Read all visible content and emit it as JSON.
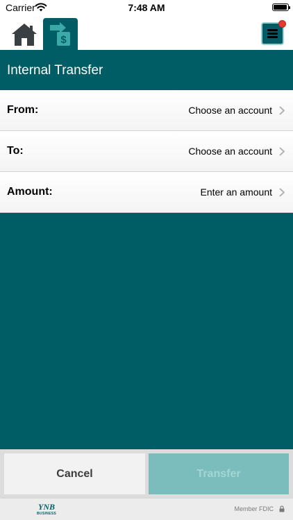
{
  "status_bar": {
    "carrier": "Carrier",
    "time": "7:48 AM",
    "icons": [
      "wifi-icon",
      "battery-icon"
    ]
  },
  "toolbar": {
    "tabs": [
      {
        "icon": "home-icon",
        "active": false
      },
      {
        "icon": "transfer-dollar-icon",
        "active": true
      }
    ],
    "menu": {
      "icon": "hamburger-menu-icon",
      "notification_badge": true
    }
  },
  "header": {
    "title": "Internal Transfer"
  },
  "form": {
    "from": {
      "label": "From:",
      "value": "Choose an account"
    },
    "to": {
      "label": "To:",
      "value": "Choose an account"
    },
    "amount": {
      "label": "Amount:",
      "value": "Enter an amount"
    }
  },
  "actions": {
    "cancel_label": "Cancel",
    "transfer_label": "Transfer",
    "transfer_enabled": false
  },
  "footer": {
    "logo_text": "YNB",
    "logo_subtext": "BUSINESS",
    "fdic_text": "Member FDIC"
  },
  "colors": {
    "brand_teal": "#005d65",
    "menu_border": "#9fd0d0",
    "disabled_button": "#7bbcbc",
    "notification_red": "#e33b2d"
  }
}
